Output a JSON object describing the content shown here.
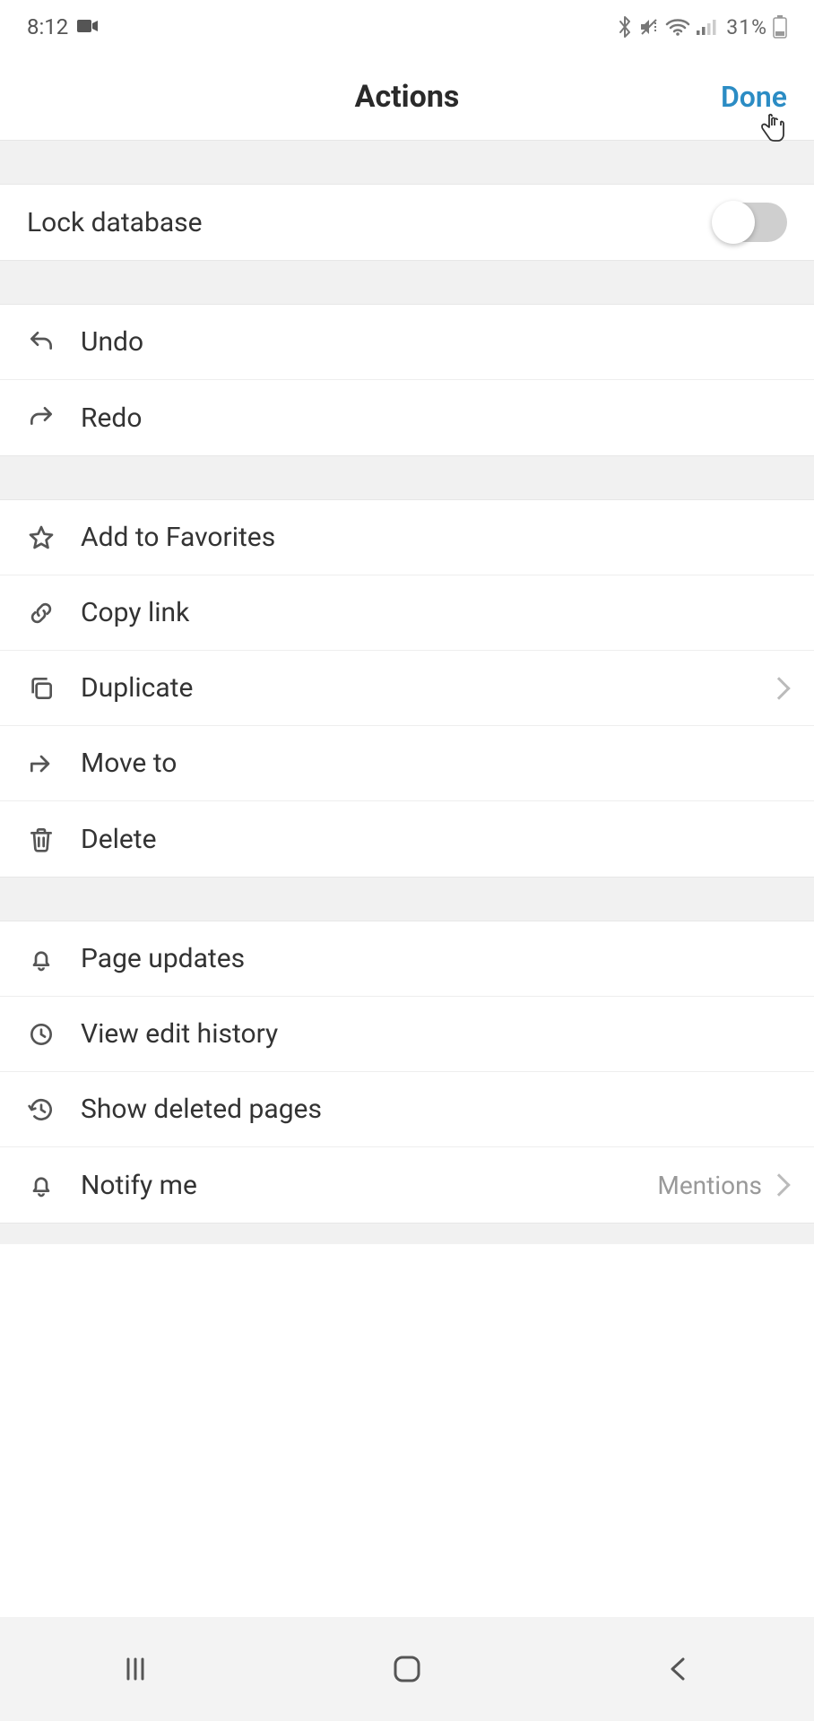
{
  "status": {
    "time": "8:12",
    "battery": "31%"
  },
  "header": {
    "title": "Actions",
    "done": "Done"
  },
  "lock": {
    "label": "Lock database",
    "on": false
  },
  "group1": [
    {
      "key": "undo",
      "label": "Undo"
    },
    {
      "key": "redo",
      "label": "Redo"
    }
  ],
  "group2": [
    {
      "key": "favorites",
      "label": "Add to Favorites"
    },
    {
      "key": "copylink",
      "label": "Copy link"
    },
    {
      "key": "duplicate",
      "label": "Duplicate",
      "chevron": true
    },
    {
      "key": "moveto",
      "label": "Move to"
    },
    {
      "key": "delete",
      "label": "Delete"
    }
  ],
  "group3": [
    {
      "key": "pageupdates",
      "label": "Page updates"
    },
    {
      "key": "viewhistory",
      "label": "View edit history"
    },
    {
      "key": "showdeleted",
      "label": "Show deleted pages"
    },
    {
      "key": "notifyme",
      "label": "Notify me",
      "trail": "Mentions",
      "chevron": true
    }
  ]
}
